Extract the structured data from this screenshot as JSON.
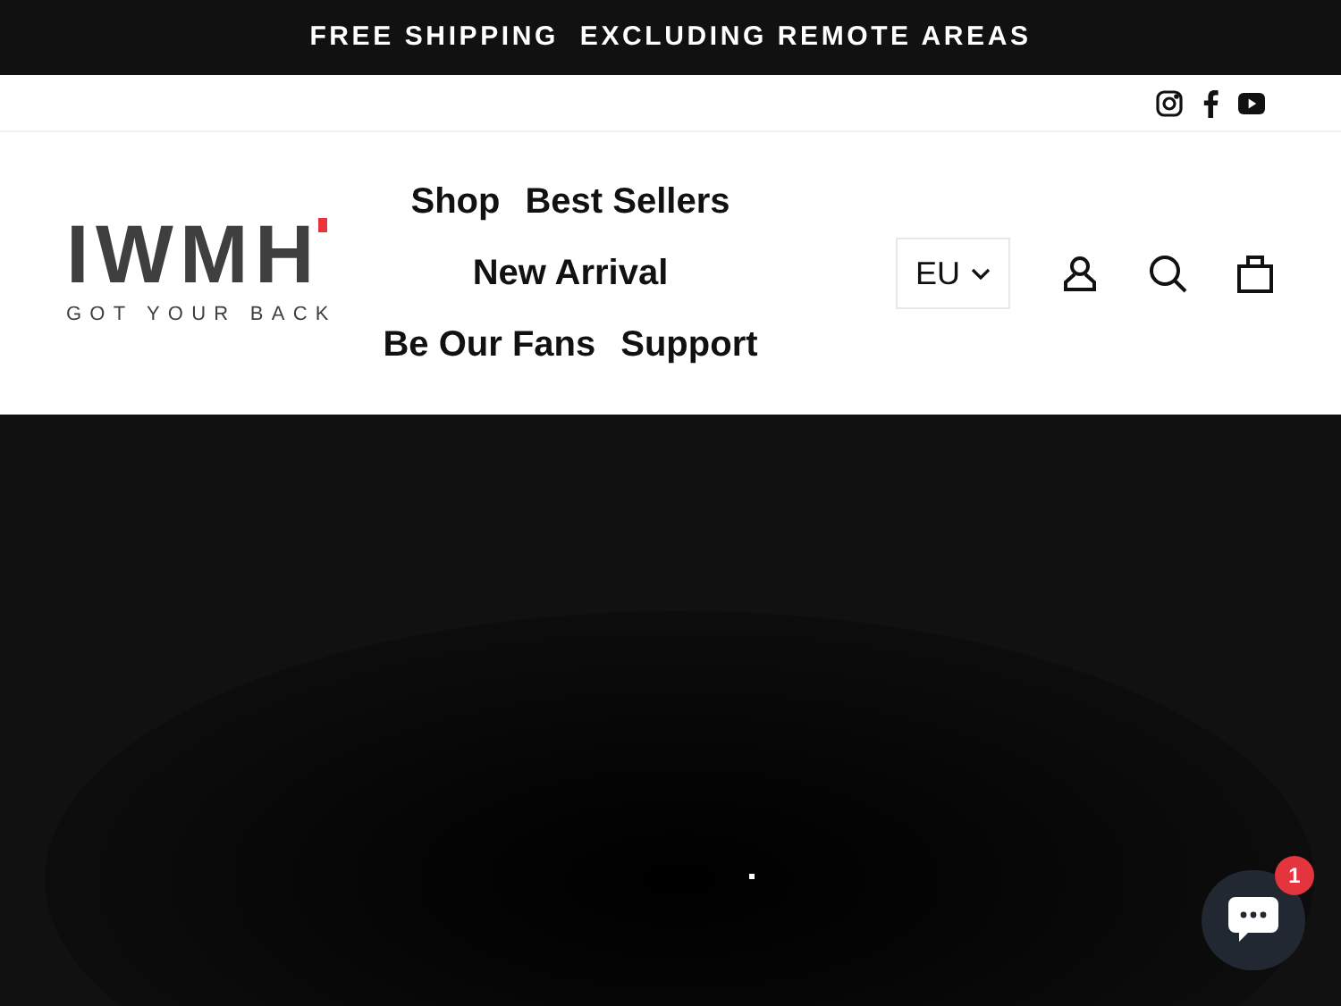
{
  "announcement": "FREE SHIPPING  EXCLUDING REMOTE AREAS",
  "logo": {
    "wordmark": "IWMH",
    "tagline": "GOT YOUR BACK"
  },
  "nav": [
    {
      "label": "Shop"
    },
    {
      "label": "Best Sellers"
    },
    {
      "label": "New Arrival"
    },
    {
      "label": "Be Our Fans"
    },
    {
      "label": "Support"
    }
  ],
  "region": "EU",
  "chat": {
    "badge": "1"
  }
}
